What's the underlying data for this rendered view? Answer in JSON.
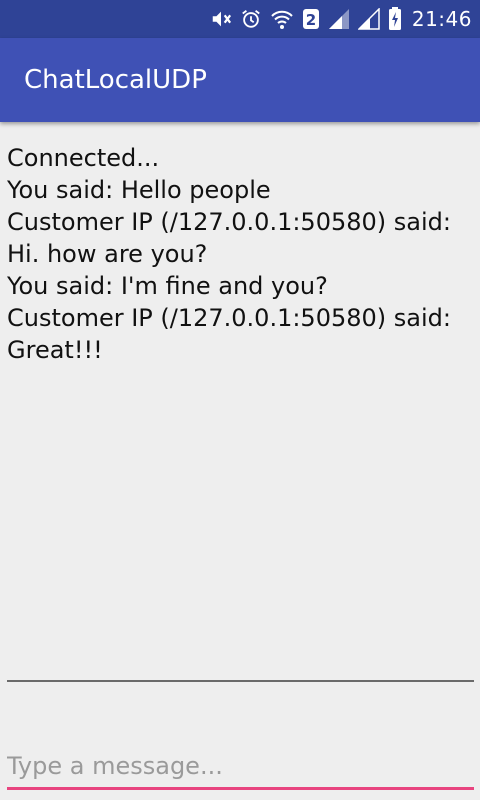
{
  "status_bar": {
    "time": "21:46",
    "sim_badge": "2",
    "icons": [
      "mute-icon",
      "alarm-icon",
      "wifi-icon",
      "sim-2-icon",
      "signal-icon",
      "signal-icon-2",
      "battery-charging-icon"
    ]
  },
  "app_bar": {
    "title": "ChatLocalUDP",
    "color": "#3f51b5"
  },
  "chat_log": {
    "lines": [
      "Connected...",
      "You said: Hello people",
      "Customer IP (/127.0.0.1:50580) said:",
      "Hi. how are you?",
      "You said: I'm fine and you?",
      "Customer IP (/127.0.0.1:50580) said:",
      "Great!!!"
    ]
  },
  "message_input": {
    "value": "",
    "placeholder": "Type a message...",
    "accent_color": "#e8447f"
  }
}
